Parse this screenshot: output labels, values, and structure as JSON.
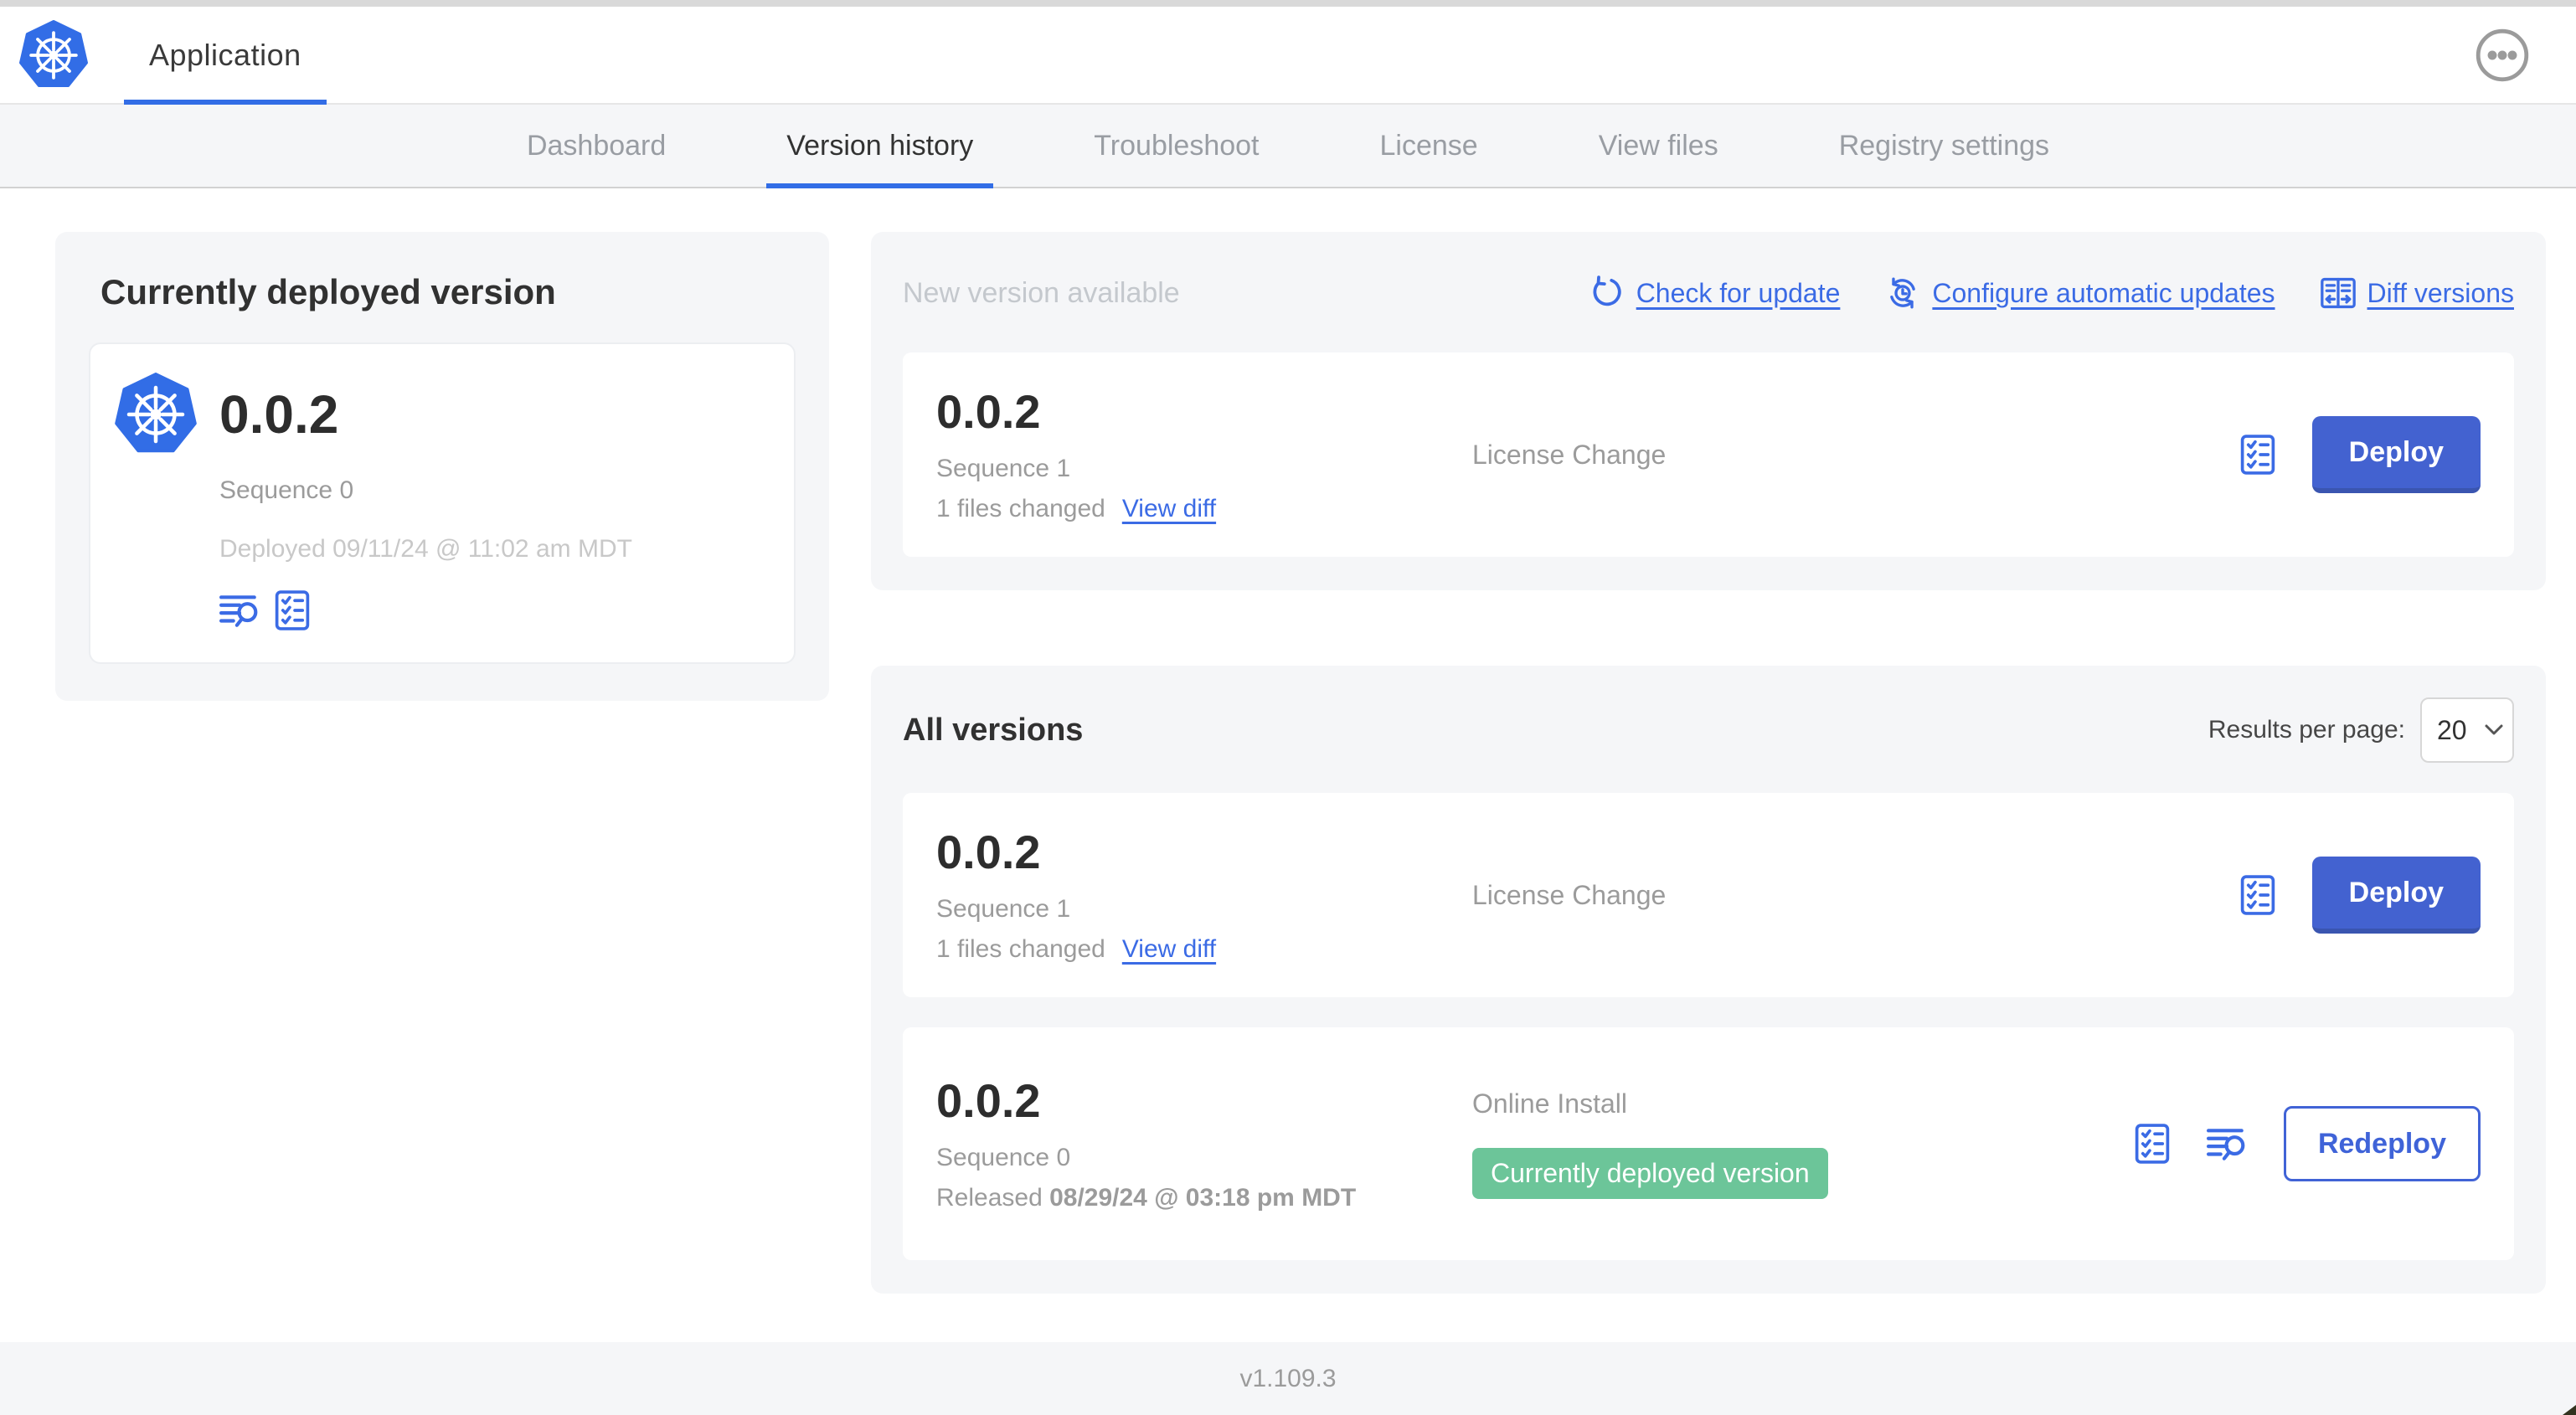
{
  "colors": {
    "accent_blue": "#3b6be5",
    "kubernetes_blue": "#326de6",
    "button_blue": "#4362d0",
    "badge_green": "#6cc599"
  },
  "icons": {
    "app_logo": "kubernetes-wheel-icon",
    "more_menu": "ellipsis-circle-icon",
    "check_for_update": "refresh-arrow-icon",
    "configure_automatic_updates": "clock-refresh-icon",
    "diff_versions": "split-diff-icon",
    "release_notes": "checklist-icon",
    "logs": "lines-magnifier-icon",
    "results_select": "chevron-down-icon"
  },
  "header": {
    "app_tab": "Application"
  },
  "nav": {
    "tabs": [
      {
        "label": "Dashboard",
        "active": false
      },
      {
        "label": "Version history",
        "active": true
      },
      {
        "label": "Troubleshoot",
        "active": false
      },
      {
        "label": "License",
        "active": false
      },
      {
        "label": "View files",
        "active": false
      },
      {
        "label": "Registry settings",
        "active": false
      }
    ]
  },
  "current_deployed": {
    "title": "Currently deployed version",
    "version": "0.0.2",
    "sequence": "Sequence 0",
    "deployed": "Deployed 09/11/24 @ 11:02 am MDT"
  },
  "new_version": {
    "title": "New version available",
    "check_for_update": "Check for update",
    "configure_automatic_updates": "Configure automatic updates",
    "diff_versions": "Diff versions",
    "card": {
      "version": "0.0.2",
      "sequence": "Sequence 1",
      "files_changed": "1 files changed",
      "view_diff": "View diff",
      "source": "License Change",
      "action_label": "Deploy"
    }
  },
  "all_versions": {
    "title": "All versions",
    "results_per_page_label": "Results per page:",
    "results_per_page_value": "20",
    "rows": [
      {
        "version": "0.0.2",
        "sequence": "Sequence 1",
        "files_changed": "1 files changed",
        "view_diff": "View diff",
        "source": "License Change",
        "action_label": "Deploy"
      },
      {
        "version": "0.0.2",
        "sequence": "Sequence 0",
        "released_prefix": "Released ",
        "released_date": "08/29/24 @ 03:18 pm MDT",
        "source": "Online Install",
        "badge": "Currently deployed version",
        "action_label": "Redeploy"
      }
    ]
  },
  "footer": {
    "app_version": "v1.109.3"
  }
}
